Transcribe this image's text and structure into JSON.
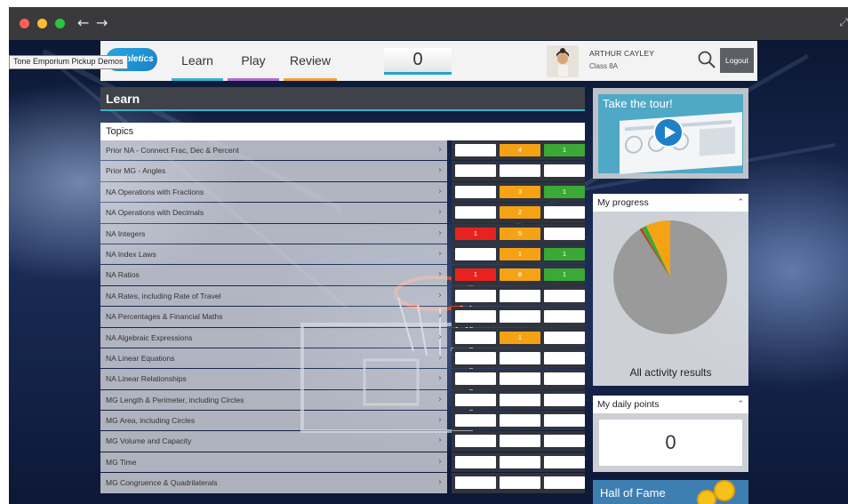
{
  "browser": {
    "back": "←",
    "forward": "→",
    "expand": "⤢"
  },
  "tooltip": "Tone Emporium Pickup Demos",
  "header": {
    "logo": "mathletics",
    "tabs": [
      {
        "label": "Learn",
        "color": "#36b3c9"
      },
      {
        "label": "Play",
        "color": "#b06cd0"
      },
      {
        "label": "Review",
        "color": "#f0a03a"
      }
    ],
    "score": "0",
    "user_name": "ARTHUR CAYLEY",
    "user_class": "Class 8A",
    "logout_label": "Logout"
  },
  "learn": {
    "title": "Learn",
    "topics_header": "Topics"
  },
  "topics": [
    {
      "name": "Prior NA - Connect Frac, Dec & Percent",
      "cells": [
        "",
        "4",
        "1"
      ]
    },
    {
      "name": "Prior MG - Angles",
      "cells": [
        "",
        "",
        ""
      ]
    },
    {
      "name": "NA Operations with Fractions",
      "cells": [
        "",
        "3",
        "1"
      ]
    },
    {
      "name": "NA Operations with Decimals",
      "cells": [
        "",
        "2",
        ""
      ]
    },
    {
      "name": "NA Integers",
      "cells": [
        "1",
        "5",
        ""
      ]
    },
    {
      "name": "NA Index Laws",
      "cells": [
        "",
        "1",
        "1"
      ]
    },
    {
      "name": "NA Ratios",
      "cells": [
        "1",
        "8",
        "1"
      ]
    },
    {
      "name": "NA Rates, including Rate of Travel",
      "cells": [
        "",
        "",
        ""
      ]
    },
    {
      "name": "NA Percentages & Financial Maths",
      "cells": [
        "",
        "",
        ""
      ]
    },
    {
      "name": "NA Algebraic Expressions",
      "cells": [
        "",
        "1",
        ""
      ]
    },
    {
      "name": "NA Linear Equations",
      "cells": [
        "",
        "",
        ""
      ]
    },
    {
      "name": "NA Linear Relationships",
      "cells": [
        "",
        "",
        ""
      ]
    },
    {
      "name": "MG Length & Perimeter, including Circles",
      "cells": [
        "",
        "",
        ""
      ]
    },
    {
      "name": "MG Area, including Circles",
      "cells": [
        "",
        "",
        ""
      ]
    },
    {
      "name": "MG Volume and Capacity",
      "cells": [
        "",
        "",
        ""
      ]
    },
    {
      "name": "MG Time",
      "cells": [
        "",
        "",
        ""
      ]
    },
    {
      "name": "MG Congruence & Quadrilaterals",
      "cells": [
        "",
        "",
        ""
      ]
    }
  ],
  "cell_colors": {
    "red": "#e8231f",
    "orange": "#f5a314",
    "green": "#3aa935",
    "empty": "#ffffff"
  },
  "tour": {
    "label": "Take the tour!"
  },
  "progress": {
    "title": "My progress",
    "caption": "All activity results",
    "pie_slices": [
      {
        "label": "gray",
        "value": 0.91,
        "color": "#9a9a9a"
      },
      {
        "label": "orange",
        "value": 0.07,
        "color": "#f5a314"
      },
      {
        "label": "green",
        "value": 0.015,
        "color": "#3aa935"
      },
      {
        "label": "red",
        "value": 0.005,
        "color": "#e8231f"
      }
    ]
  },
  "daily_points": {
    "title": "My daily points",
    "value": "0"
  },
  "hall_of_fame": {
    "title": "Hall of Fame"
  }
}
